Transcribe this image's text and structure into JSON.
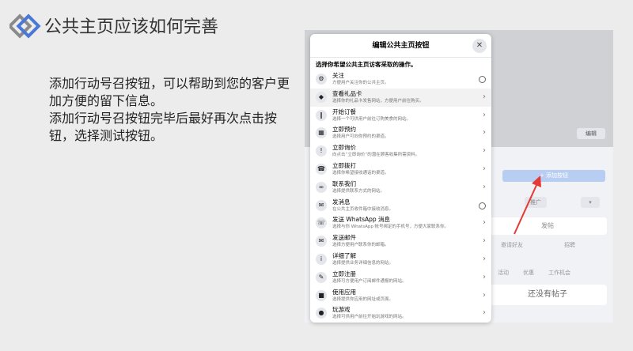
{
  "slide": {
    "title": "公共主页应该如何完善",
    "paragraphs": [
      "添加行动号召按钮，可以帮助到您的客户更加方便的留下信息。",
      "添加行动号召按钮完毕后最好再次点击按钮，选择测试按钮。"
    ],
    "accent_color": "#4a78d6",
    "arrow_color": "#e53935"
  },
  "background": {
    "edit_cover": "编辑",
    "cta_button": "+ 添加按钮",
    "promote": "推广",
    "post_placeholder": "发帖",
    "chip_1": "邀请好友",
    "chip_2": "招聘",
    "chip_3": "活动",
    "chip_4": "优惠",
    "chip_5": "工作机会",
    "no_posts": "还没有帖子"
  },
  "modal": {
    "title": "编辑公共主页按钮",
    "subtitle": "选择你希望公共主页访客采取的操作。",
    "close_icon": "close-icon",
    "options": [
      {
        "label": "关注",
        "desc": "方便用户关注你的公共主页。",
        "end": "radio",
        "icon": "gear-icon"
      },
      {
        "label": "查看礼品卡",
        "desc": "选择你的礼品卡发售网站，方便用户前往购买。",
        "end": "chevron",
        "icon": "gift-card-icon"
      },
      {
        "label": "开始订餐",
        "desc": "选择一个可供用户前往订购美食的网站。",
        "end": "chevron",
        "icon": "utensils-icon"
      },
      {
        "label": "立即预约",
        "desc": "选择用户可向你预约的渠道。",
        "end": "chevron",
        "icon": "calendar-icon"
      },
      {
        "label": "立即询价",
        "desc": "向点击“立即询价”的潜在顾客收集所需资料。",
        "end": "chevron",
        "icon": "quote-icon"
      },
      {
        "label": "立即拨打",
        "desc": "选择你希望接收通话的渠道。",
        "end": "chevron",
        "icon": "phone-icon"
      },
      {
        "label": "联系我们",
        "desc": "选择提供联系方式的网站。",
        "end": "chevron",
        "icon": "link-icon"
      },
      {
        "label": "发消息",
        "desc": "在公共主页收件箱中接收消息。",
        "end": "radio",
        "icon": "messenger-icon"
      },
      {
        "label": "发送 WhatsApp 消息",
        "desc": "选择与你 WhatsApp 帐号绑定的手机号，方便大家联系你。",
        "end": "chevron",
        "icon": "whatsapp-icon"
      },
      {
        "label": "发送邮件",
        "desc": "选择方便用户联系你的邮箱。",
        "end": "chevron",
        "icon": "mail-icon"
      },
      {
        "label": "详细了解",
        "desc": "选择提供业务详细信息的网站。",
        "end": "chevron",
        "icon": "info-icon"
      },
      {
        "label": "立即注册",
        "desc": "选择可方便用户订阅邮件通报的网站。",
        "end": "chevron",
        "icon": "pencil-icon"
      },
      {
        "label": "使用应用",
        "desc": "选择提供你应用的网址或页面。",
        "end": "chevron",
        "icon": "box-icon"
      },
      {
        "label": "玩游戏",
        "desc": "选择可供用户前往开始玩游戏的网站。",
        "end": "chevron",
        "icon": "game-icon"
      }
    ]
  }
}
